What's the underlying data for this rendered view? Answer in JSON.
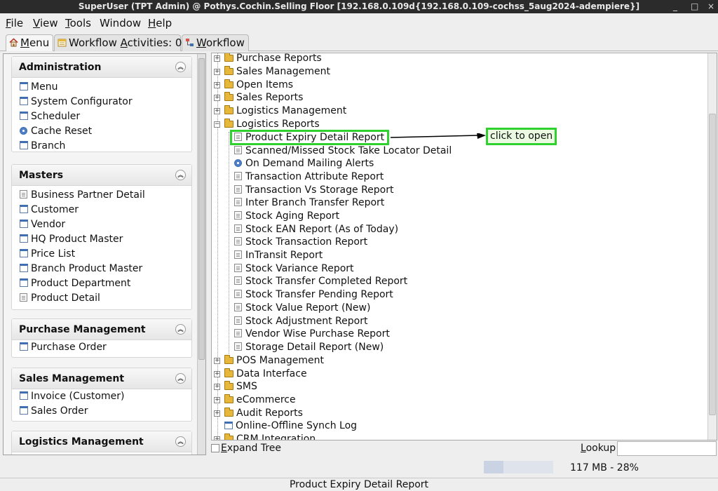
{
  "window": {
    "title": "SuperUser (TPT Admin) @ Pothys.Cochin.Selling Floor [192.168.0.109d{192.168.0.109-cochss_5aug2024-adempiere}]",
    "minimize": "_",
    "maximize": "□",
    "close": "×"
  },
  "menubar": {
    "file": {
      "mn": "F",
      "rest": "ile"
    },
    "view": {
      "mn": "V",
      "rest": "iew"
    },
    "tools": {
      "mn": "T",
      "rest": "ools"
    },
    "window": {
      "pre": "W",
      "rest": "indow"
    },
    "help": {
      "mn": "H",
      "rest": "elp"
    }
  },
  "tabs": {
    "menu": {
      "mn": "M",
      "rest": "enu"
    },
    "workflow_activities": {
      "pre": "Workflow ",
      "mn": "A",
      "rest": "ctivities: 0"
    },
    "workflow": {
      "mn": "W",
      "rest": "orkflow"
    }
  },
  "sidebar": {
    "sections": [
      {
        "title": "Administration",
        "items": [
          {
            "label": "Menu",
            "icon": "window-icon"
          },
          {
            "label": "System Configurator",
            "icon": "window-icon"
          },
          {
            "label": "Scheduler",
            "icon": "window-icon"
          },
          {
            "label": "Cache Reset",
            "icon": "gear-icon"
          },
          {
            "label": "Branch",
            "icon": "window-icon"
          }
        ]
      },
      {
        "title": "Masters",
        "items": [
          {
            "label": "Business Partner Detail",
            "icon": "report-icon"
          },
          {
            "label": "Customer",
            "icon": "window-icon"
          },
          {
            "label": "Vendor",
            "icon": "window-icon"
          },
          {
            "label": "HQ Product Master",
            "icon": "window-icon"
          },
          {
            "label": "Price List",
            "icon": "window-icon"
          },
          {
            "label": "Branch Product Master",
            "icon": "window-icon"
          },
          {
            "label": "Product Department",
            "icon": "window-icon"
          },
          {
            "label": "Product Detail",
            "icon": "report-icon"
          }
        ]
      },
      {
        "title": "Purchase Management",
        "items": [
          {
            "label": "Purchase Order",
            "icon": "window-icon"
          }
        ]
      },
      {
        "title": "Sales Management",
        "items": [
          {
            "label": "Invoice (Customer)",
            "icon": "window-icon"
          },
          {
            "label": "Sales Order",
            "icon": "window-icon"
          }
        ]
      },
      {
        "title": "Logistics Management",
        "items": []
      }
    ],
    "collapse_glyph": "︽"
  },
  "tree": {
    "top_folders": [
      "Purchase Reports",
      "Sales Management",
      "Open Items",
      "Sales Reports",
      "Logistics Management"
    ],
    "open_folder": "Logistics Reports",
    "children": [
      {
        "label": "Product Expiry Detail Report",
        "icon": "report-icon"
      },
      {
        "label": "Scanned/Missed Stock Take Locator Detail",
        "icon": "report-icon"
      },
      {
        "label": "On Demand Mailing Alerts",
        "icon": "gear-icon"
      },
      {
        "label": "Transaction Attribute Report",
        "icon": "report-icon"
      },
      {
        "label": "Transaction Vs Storage Report",
        "icon": "report-icon"
      },
      {
        "label": "Inter Branch Transfer Report",
        "icon": "report-icon"
      },
      {
        "label": "Stock Aging Report",
        "icon": "report-icon"
      },
      {
        "label": "Stock EAN Report (As of Today)",
        "icon": "report-icon"
      },
      {
        "label": "Stock Transaction Report",
        "icon": "report-icon"
      },
      {
        "label": "InTransit Report",
        "icon": "report-icon"
      },
      {
        "label": "Stock Variance Report",
        "icon": "report-icon"
      },
      {
        "label": "Stock Transfer Completed Report",
        "icon": "report-icon"
      },
      {
        "label": "Stock Transfer Pending Report",
        "icon": "report-icon"
      },
      {
        "label": "Stock Value Report (New)",
        "icon": "report-icon"
      },
      {
        "label": "Stock Adjustment Report",
        "icon": "report-icon"
      },
      {
        "label": "Vendor Wise Purchase Report",
        "icon": "report-icon"
      },
      {
        "label": "Storage Detail Report (New)",
        "icon": "report-icon"
      }
    ],
    "bottom_folders": [
      "POS Management",
      "Data Interface",
      "SMS",
      "eCommerce",
      "Audit Reports"
    ],
    "window_item": "Online-Offline Synch Log",
    "partial_item": "CRM Integration",
    "expand_plus": "+",
    "expand_minus": "−"
  },
  "annotation": {
    "callout": "click to open"
  },
  "bottom": {
    "expand_tree": {
      "mn": "E",
      "rest": "xpand Tree"
    },
    "lookup": {
      "mn": "L",
      "rest": "ookup"
    },
    "lookup_value": "",
    "memory": "117 MB - 28%",
    "memory_percent": 28,
    "status": "Product Expiry Detail Report"
  }
}
